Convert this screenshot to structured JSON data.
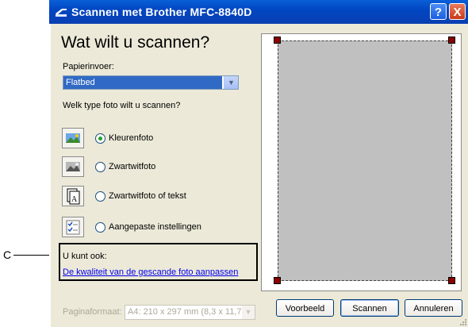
{
  "annotation": {
    "callout_label": "C"
  },
  "window": {
    "title": "Scannen met Brother MFC-8840D",
    "help_label": "?",
    "close_label": "X",
    "heading": "Wat wilt u scannen?",
    "paper_source_label": "Papierinvoer:",
    "paper_source_value": "Flatbed",
    "photo_type_question": "Welk type foto wilt u scannen?",
    "options": [
      {
        "label": "Kleurenfoto",
        "icon": "color-photo-icon",
        "checked": true
      },
      {
        "label": "Zwartwitfoto",
        "icon": "grayscale-photo-icon",
        "checked": false
      },
      {
        "label": "Zwartwitfoto of tekst",
        "icon": "text-document-icon",
        "checked": false
      },
      {
        "label": "Aangepaste instellingen",
        "icon": "custom-settings-icon",
        "checked": false
      }
    ],
    "also_label": "U kunt ook:",
    "quality_link": "De kwaliteit van de gescande foto aanpassen",
    "page_size_label": "Paginaformaat:",
    "page_size_value": "A4: 210 x 297 mm (8,3 x 11,7",
    "buttons": {
      "preview": "Voorbeeld",
      "scan": "Scannen",
      "cancel": "Annuleren"
    }
  },
  "colors": {
    "titlebar": "#0a4fc8",
    "dialog_bg": "#ece9d8",
    "selection": "#316ac5",
    "preview_bg": "#c0c0c0",
    "handle": "#8b0000",
    "radio_dot": "#21a121"
  }
}
